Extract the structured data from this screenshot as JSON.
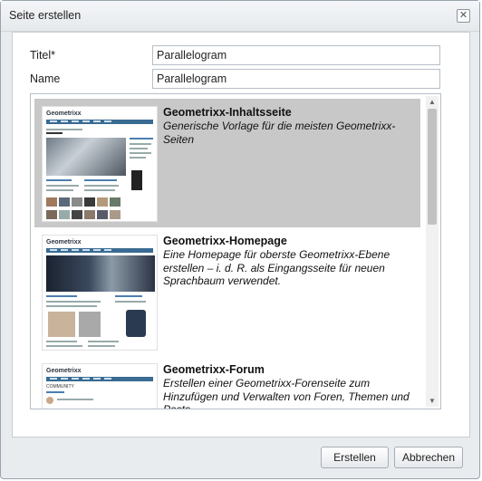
{
  "dialog": {
    "title": "Seite erstellen",
    "close_icon": "close-icon"
  },
  "form": {
    "title_label": "Titel*",
    "title_value": "Parallelogram",
    "name_label": "Name",
    "name_value": "Parallelogram"
  },
  "templates": [
    {
      "name": "Geometrixx-Inhaltsseite",
      "description": "Generische Vorlage für die meisten Geometrixx-Seiten",
      "selected": true
    },
    {
      "name": "Geometrixx-Homepage",
      "description": "Eine Homepage für oberste Geometrixx-Ebene erstellen – i. d. R. als Eingangsseite für neuen Sprachbaum verwendet.",
      "selected": false
    },
    {
      "name": "Geometrixx-Forum",
      "description": "Erstellen einer Geometrixx-Forenseite zum Hinzufügen und Verwalten von Foren, Themen und Posts.",
      "selected": false
    }
  ],
  "thumbs": {
    "logo": "Geometrixx",
    "page_heading": "COMMUNITY"
  },
  "buttons": {
    "create": "Erstellen",
    "cancel": "Abbrechen"
  },
  "colors": {
    "selected_bg": "#c8c8c8",
    "nav_blue": "#3a6b93"
  }
}
